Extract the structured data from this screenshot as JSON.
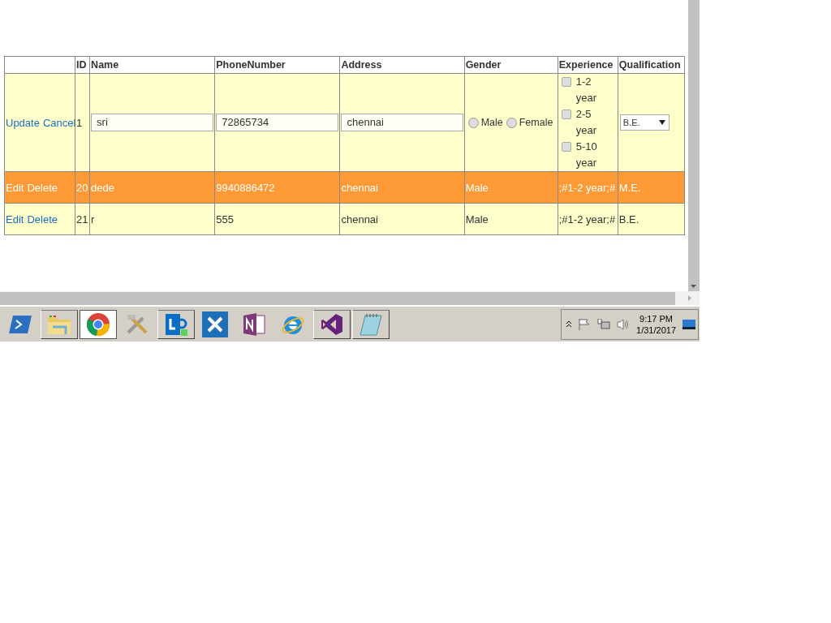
{
  "table": {
    "columns": [
      "ID",
      "Name",
      "PhoneNumber",
      "Address",
      "Gender",
      "Experience",
      "Qualification"
    ],
    "rows": [
      {
        "kind": "edit",
        "selected": false,
        "actions": [
          "Update",
          "Cancel"
        ],
        "id": "1",
        "name": "sri",
        "phone": "72865734",
        "address": "chennai",
        "gender": [
          {
            "label": "Male",
            "selected": false
          },
          {
            "label": "Female",
            "selected": false
          }
        ],
        "experience": [
          {
            "label": "1-2 year",
            "checked": false
          },
          {
            "label": "2-5 year",
            "checked": false
          },
          {
            "label": "5-10 year",
            "checked": false
          }
        ],
        "qualification": "B.E."
      },
      {
        "kind": "view",
        "selected": true,
        "actions": [
          "Edit",
          "Delete"
        ],
        "id": "20",
        "name": "dede",
        "phone": "9940886472",
        "address": "chennai",
        "gender": "Male",
        "experience": ";#1-2 year;#",
        "qualification": "M.E."
      },
      {
        "kind": "view",
        "selected": false,
        "actions": [
          "Edit",
          "Delete"
        ],
        "id": "21",
        "name": "r",
        "phone": "555",
        "address": "chennai",
        "gender": "Male",
        "experience": ";#1-2 year;#",
        "qualification": "B.E."
      }
    ]
  },
  "taskbar": {
    "apps": [
      {
        "kind": "terminal",
        "running": false,
        "selected": false
      },
      {
        "kind": "folder",
        "running": true,
        "selected": false
      },
      {
        "kind": "browser",
        "running": true,
        "selected": true
      },
      {
        "kind": "tools",
        "running": false,
        "selected": false
      },
      {
        "kind": "lync",
        "running": true,
        "selected": false
      },
      {
        "kind": "wrench",
        "running": false,
        "selected": false
      },
      {
        "kind": "onenote",
        "running": false,
        "selected": false
      },
      {
        "kind": "ie",
        "running": false,
        "selected": false
      },
      {
        "kind": "vs",
        "running": true,
        "selected": false
      },
      {
        "kind": "notepad",
        "running": true,
        "selected": false
      }
    ],
    "time": "9:17 PM",
    "date": "1/31/2017"
  }
}
